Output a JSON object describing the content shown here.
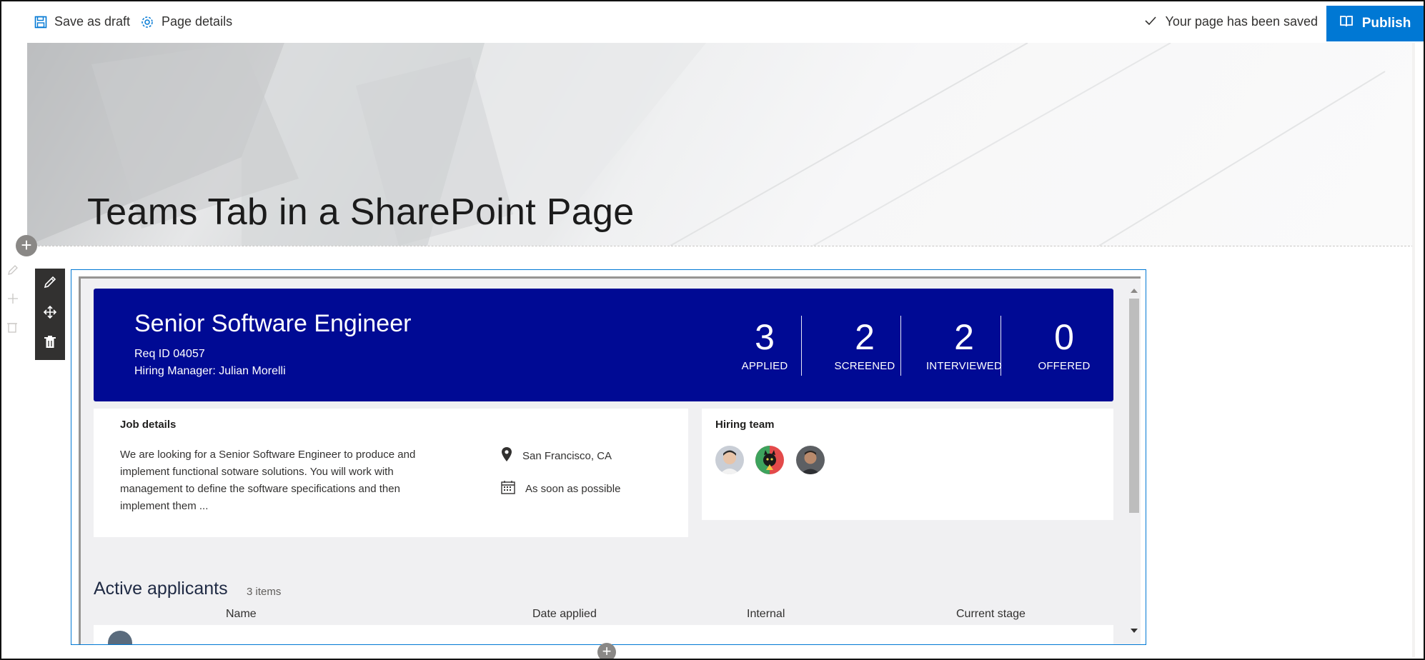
{
  "command_bar": {
    "save_draft_label": "Save as draft",
    "page_details_label": "Page details",
    "saved_status": "Your page has been saved",
    "publish_label": "Publish",
    "accent_color": "#0078d4"
  },
  "page": {
    "title": "Teams Tab in a SharePoint Page"
  },
  "job": {
    "title": "Senior Software Engineer",
    "req_id": "Req ID 04057",
    "hiring_manager": "Hiring Manager: Julian Morelli",
    "banner_color": "#000a94",
    "stats": [
      {
        "value": "3",
        "label": "APPLIED"
      },
      {
        "value": "2",
        "label": "SCREENED"
      },
      {
        "value": "2",
        "label": "INTERVIEWED"
      },
      {
        "value": "0",
        "label": "OFFERED"
      }
    ]
  },
  "job_details": {
    "heading": "Job details",
    "description": "We are looking for a Senior Software Engineer to produce and implement functional sotware solutions. You will work with management to define the software specifications and then implement them ...",
    "location": "San Francisco, CA",
    "start": "As soon as possible"
  },
  "hiring_team": {
    "heading": "Hiring team",
    "members": [
      "avatar-1",
      "avatar-2",
      "avatar-3"
    ]
  },
  "applicants": {
    "heading": "Active applicants",
    "count_label": "3 items",
    "columns": [
      "Name",
      "Date applied",
      "Internal",
      "Current stage"
    ]
  },
  "icons": [
    "save-icon",
    "gear-icon",
    "check-icon",
    "book-icon",
    "pencil-icon",
    "move-icon",
    "trash-icon",
    "map-pin-icon",
    "calendar-icon",
    "plus-icon"
  ]
}
